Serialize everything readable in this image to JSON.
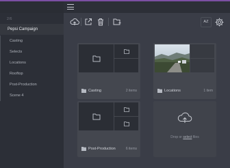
{
  "sidebar": {
    "caption": "2/6",
    "items": [
      {
        "label": "Pepsi Campaign"
      },
      {
        "label": "Casting"
      },
      {
        "label": "Selects"
      },
      {
        "label": "Locations"
      },
      {
        "label": "Rooftop"
      },
      {
        "label": "Post-Production"
      },
      {
        "label": "Scene 4"
      }
    ]
  },
  "toolbar": {
    "sort_label": "AZ",
    "icons": [
      "upload-cloud-icon",
      "share-icon",
      "trash-icon",
      "new-folder-icon",
      "gear-icon"
    ]
  },
  "folders": [
    {
      "name": "Casting",
      "count": "2 items"
    },
    {
      "name": "Locations",
      "count": "1 item"
    },
    {
      "name": "Post-Production",
      "count": "6 items"
    }
  ],
  "upload": {
    "text_before": "Drop or ",
    "link": "select",
    "text_after": " files"
  },
  "colors": {
    "accent": "#7b4fa3",
    "background": "#3a3d47",
    "sidebar": "#2c2f37"
  }
}
